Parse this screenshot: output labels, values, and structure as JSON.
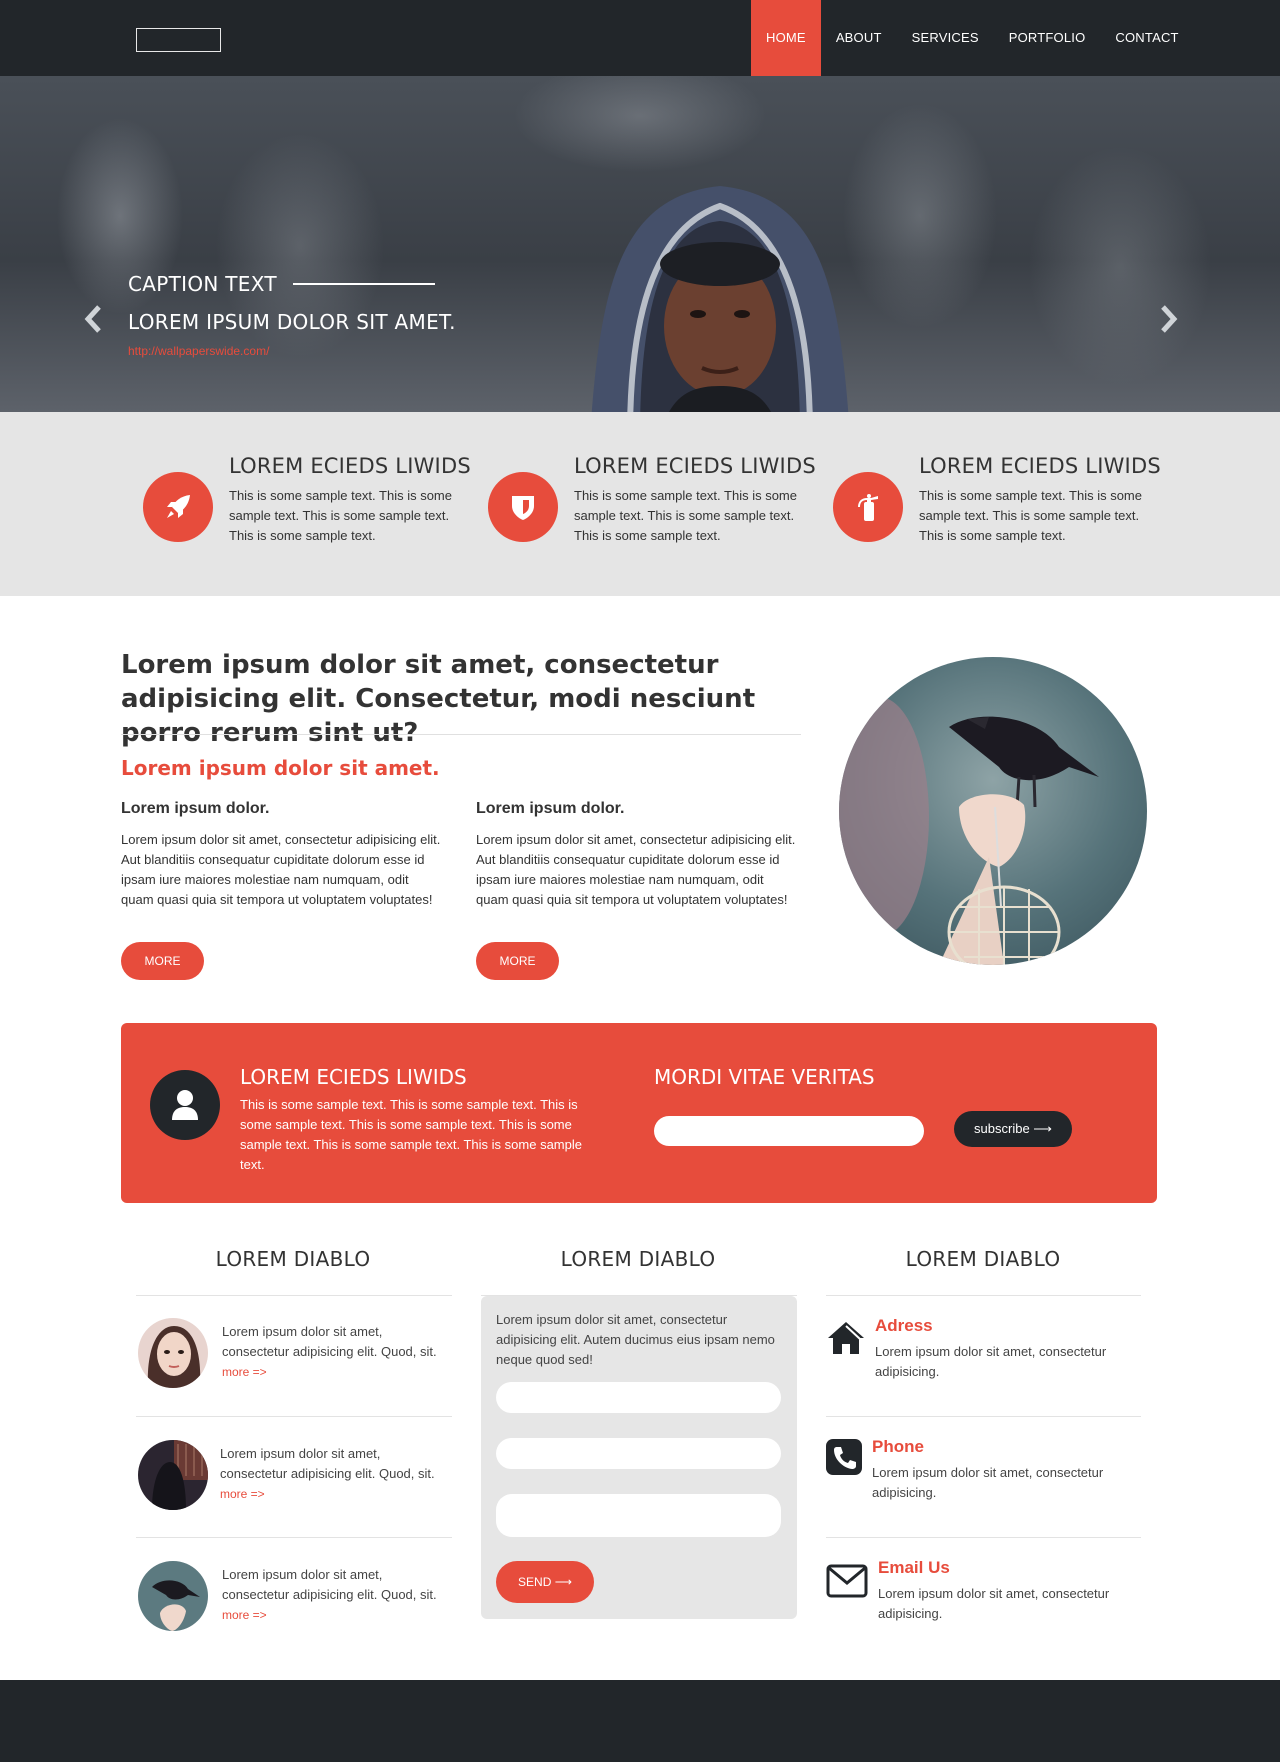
{
  "nav": {
    "items": [
      {
        "label": "HOME",
        "active": true
      },
      {
        "label": "ABOUT",
        "active": false
      },
      {
        "label": "SERVICES",
        "active": false
      },
      {
        "label": "PORTFOLIO",
        "active": false
      },
      {
        "label": "CONTACT",
        "active": false
      }
    ]
  },
  "hero": {
    "caption_title": "CAPTION TEXT",
    "caption_sub": "LOREM IPSUM DOLOR SIT AMET.",
    "caption_link": "http://wallpaperswide.com/",
    "prev_icon": "chevron-left-icon",
    "next_icon": "chevron-right-icon"
  },
  "features": [
    {
      "icon": "rocket-icon",
      "title": "LOREM ECIEDS LIWIDS",
      "text": "This is some sample text. This is some sample text. This is some sample text. This is some sample text."
    },
    {
      "icon": "shield-icon",
      "title": "LOREM ECIEDS LIWIDS",
      "text": "This is some sample text. This is some sample text. This is some sample text. This is some sample text."
    },
    {
      "icon": "fire-extinguisher-icon",
      "title": "LOREM ECIEDS LIWIDS",
      "text": "This is some sample text. This is some sample text. This is some sample text. This is some sample text."
    }
  ],
  "intro": {
    "title": "Lorem ipsum dolor sit amet, consectetur adipisicing elit. Consectetur, modi nesciunt porro rerum sint ut?",
    "subtitle": "Lorem ipsum dolor sit amet.",
    "columns": [
      {
        "heading": "Lorem ipsum dolor.",
        "text": "Lorem ipsum dolor sit amet, consectetur adipisicing elit. Aut blanditiis consequatur cupiditate dolorum esse id ipsam iure maiores molestiae nam numquam, odit quam quasi quia sit tempora ut voluptatem voluptates!",
        "button": "MORE"
      },
      {
        "heading": "Lorem ipsum dolor.",
        "text": "Lorem ipsum dolor sit amet, consectetur adipisicing elit. Aut blanditiis consequatur cupiditate dolorum esse id ipsam iure maiores molestiae nam numquam, odit quam quasi quia sit tempora ut voluptatem voluptates!",
        "button": "MORE"
      }
    ]
  },
  "banner": {
    "icon": "user-icon",
    "title": "LOREM ECIEDS LIWIDS",
    "text": "This is some sample text. This is some sample text. This is some sample text. This is some sample text. This is some sample text. This is some sample text. This is some sample text.",
    "subscribe_title": "MORDI VITAE VERITAS",
    "subscribe_value": "",
    "subscribe_button": "subscribe ⟶"
  },
  "bottom": {
    "col_titles": [
      "LOREM DIABLO",
      "LOREM DIABLO",
      "LOREM DIABLO"
    ],
    "posts": [
      {
        "text": "Lorem ipsum dolor sit amet, consectetur adipisicing elit. Quod, sit.",
        "more": "more =>"
      },
      {
        "text": "Lorem ipsum dolor sit amet, consectetur adipisicing elit. Quod, sit.",
        "more": "more =>"
      },
      {
        "text": "Lorem ipsum dolor sit amet, consectetur adipisicing elit. Quod, sit.",
        "more": "more =>"
      }
    ],
    "form": {
      "text": "Lorem ipsum dolor sit amet, consectetur adipisicing elit. Autem ducimus eius ipsam nemo neque quod sed!",
      "send": "SEND ⟶"
    },
    "contacts": [
      {
        "icon": "home-icon",
        "title": "Adress",
        "text": "Lorem ipsum dolor sit amet, consectetur adipisicing."
      },
      {
        "icon": "phone-icon",
        "title": "Phone",
        "text": "Lorem ipsum dolor sit amet, consectetur adipisicing."
      },
      {
        "icon": "envelope-icon",
        "title": "Email Us",
        "text": "Lorem ipsum dolor sit amet, consectetur adipisicing."
      }
    ]
  },
  "colors": {
    "accent": "#e74c3c",
    "dark": "#22262a",
    "band": "#e5e5e5"
  }
}
